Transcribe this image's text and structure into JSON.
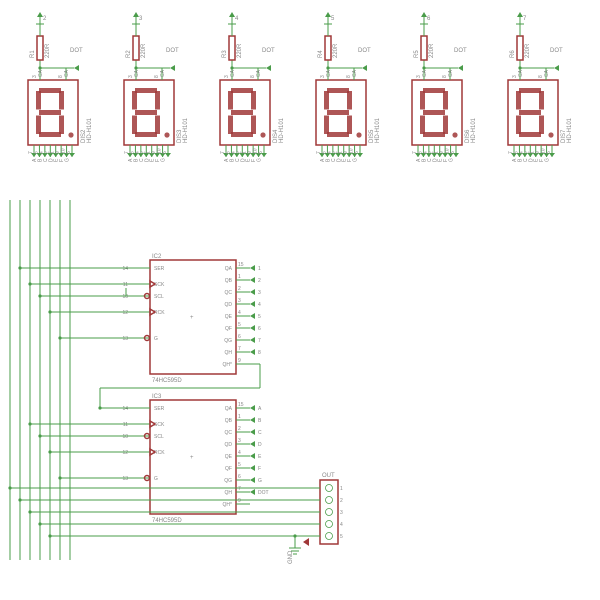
{
  "displays": [
    {
      "ref": "DIS2",
      "part": "HD-H101",
      "resistor": "R1",
      "rval": "220R",
      "dot": "DOT"
    },
    {
      "ref": "DIS3",
      "part": "HD-H101",
      "resistor": "R2",
      "rval": "220R",
      "dot": "DOT"
    },
    {
      "ref": "DIS4",
      "part": "HD-H101",
      "resistor": "R3",
      "rval": "220R",
      "dot": "DOT"
    },
    {
      "ref": "DIS5",
      "part": "HD-H101",
      "resistor": "R4",
      "rval": "220R",
      "dot": "DOT"
    },
    {
      "ref": "DIS6",
      "part": "HD-H101",
      "resistor": "R5",
      "rval": "220R",
      "dot": "DOT"
    },
    {
      "ref": "DIS7",
      "part": "HD-H101",
      "resistor": "R6",
      "rval": "220R",
      "dot": "DOT"
    }
  ],
  "display_pins_bottom": [
    "7",
    "6",
    "4",
    "2",
    "1",
    "9",
    "10",
    "5"
  ],
  "display_seg_labels": [
    "A",
    "B",
    "C",
    "D",
    "E",
    "F",
    "G"
  ],
  "display_pins_top": [
    "3",
    "8"
  ],
  "display_top_labels": [
    "CA",
    "CA"
  ],
  "ic2": {
    "ref": "IC2",
    "part": "74HC595D",
    "left_pins": [
      {
        "num": "14",
        "name": "SER"
      },
      {
        "num": "11",
        "name": "SCK"
      },
      {
        "num": "10",
        "name": "SCL"
      },
      {
        "num": "12",
        "name": "RCK"
      },
      {
        "num": "13",
        "name": "G"
      }
    ],
    "right_pins": [
      {
        "num": "15",
        "name": "QA",
        "net": "1"
      },
      {
        "num": "1",
        "name": "QB",
        "net": "2"
      },
      {
        "num": "2",
        "name": "QC",
        "net": "3"
      },
      {
        "num": "3",
        "name": "QD",
        "net": "4"
      },
      {
        "num": "4",
        "name": "QE",
        "net": "5"
      },
      {
        "num": "5",
        "name": "QF",
        "net": "6"
      },
      {
        "num": "6",
        "name": "QG",
        "net": "7"
      },
      {
        "num": "7",
        "name": "QH",
        "net": "8"
      },
      {
        "num": "9",
        "name": "QH*"
      }
    ]
  },
  "ic3": {
    "ref": "IC3",
    "part": "74HC595D",
    "left_pins": [
      {
        "num": "14",
        "name": "SER"
      },
      {
        "num": "11",
        "name": "SCK"
      },
      {
        "num": "10",
        "name": "SCL"
      },
      {
        "num": "12",
        "name": "RCK"
      },
      {
        "num": "13",
        "name": "G"
      }
    ],
    "right_pins": [
      {
        "num": "15",
        "name": "QA",
        "net": "A"
      },
      {
        "num": "1",
        "name": "QB",
        "net": "B"
      },
      {
        "num": "2",
        "name": "QC",
        "net": "C"
      },
      {
        "num": "3",
        "name": "QD",
        "net": "D"
      },
      {
        "num": "4",
        "name": "QE",
        "net": "E"
      },
      {
        "num": "5",
        "name": "QF",
        "net": "F"
      },
      {
        "num": "6",
        "name": "QG",
        "net": "G"
      },
      {
        "num": "7",
        "name": "QH",
        "net": "DOT"
      },
      {
        "num": "9",
        "name": "QH*"
      }
    ]
  },
  "connector": {
    "ref": "OUT",
    "pins": [
      "1",
      "2",
      "3",
      "4",
      "5"
    ]
  },
  "gnd": "GND",
  "plus": "+"
}
